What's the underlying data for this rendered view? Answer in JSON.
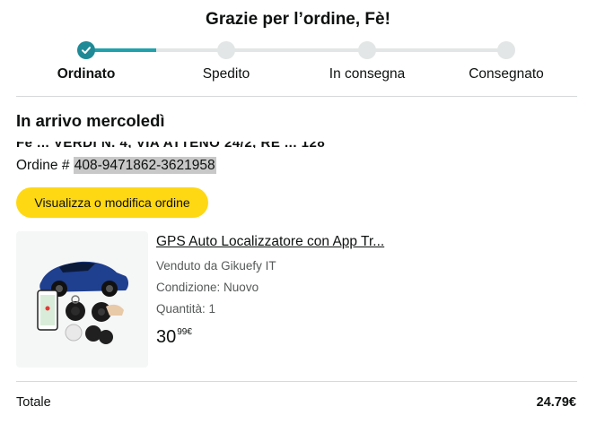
{
  "header": {
    "title": "Grazie per l’ordine, Fè!"
  },
  "tracker": {
    "steps": [
      {
        "label": "Ordinato"
      },
      {
        "label": "Spedito"
      },
      {
        "label": "In consegna"
      },
      {
        "label": "Consegnato"
      }
    ],
    "current_step": 1,
    "accent_color": "#1f8a96"
  },
  "delivery": {
    "arrival_text": "In arrivo mercoledì",
    "address_partial": "Fè ... VERDI N. 4, VIA ATTENO 24/2, RE ... 128",
    "order_label": "Ordine #",
    "order_number": "408-9471862-3621958"
  },
  "actions": {
    "view_edit_label": "Visualizza o modifica ordine",
    "button_color": "#ffd814"
  },
  "product": {
    "title": "GPS Auto Localizzatore con App Tr...",
    "seller": "Venduto da Gikuefy IT",
    "condition": "Condizione: Nuovo",
    "quantity": "Quantità: 1",
    "price_whole": "30",
    "price_fraction": "99€",
    "image_icon": "gps-tracker-car-product-image"
  },
  "summary": {
    "total_label": "Totale",
    "total_value": "24.79€"
  }
}
